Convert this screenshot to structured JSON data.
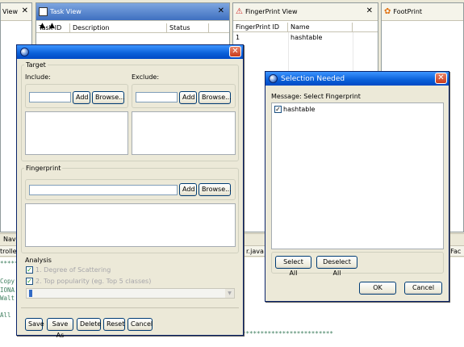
{
  "left_strip": {
    "tab_label": "View",
    "close": "✕"
  },
  "task_view": {
    "title": "Task View",
    "columns": [
      "Task ID",
      "Description",
      "Status"
    ]
  },
  "fingerprint_view": {
    "title": "FingerPrint View",
    "columns": [
      "FingerPrint ID",
      "Name"
    ],
    "rows": [
      {
        "id": "1",
        "name": "hashtable"
      }
    ]
  },
  "footprint_view": {
    "title": "FootPrint"
  },
  "bottom_tabs": {
    "navi": "Navi",
    "controller": "troller",
    "java": "r.java",
    "fac": "nFac"
  },
  "console": {
    "stars": "*****",
    "lines": [
      "Copy",
      "IONA",
      "Walt",
      "",
      "All"
    ],
    "bottom_stars": "*************************"
  },
  "main_dialog": {
    "target_label": "Target",
    "include_label": "Include:",
    "exclude_label": "Exclude:",
    "add_label": "Add",
    "browse_label": "Browse...",
    "fingerprint_label": "Fingerprint",
    "analysis_label": "Analysis",
    "option1": "1. Degree of Scattering",
    "option2": "2. Top popularity (eg. Top 5 classes)",
    "buttons": {
      "save": "Save",
      "save_as": "Save As",
      "delete": "Delete",
      "reset": "Reset",
      "cancel": "Cancel"
    }
  },
  "selection_dialog": {
    "title": "Selection Needed",
    "message": "Message: Select Fingerprint",
    "items": [
      {
        "label": "hashtable",
        "checked": true
      }
    ],
    "select_all": "Select All",
    "deselect_all": "Deselect All",
    "ok": "OK",
    "cancel": "Cancel"
  }
}
